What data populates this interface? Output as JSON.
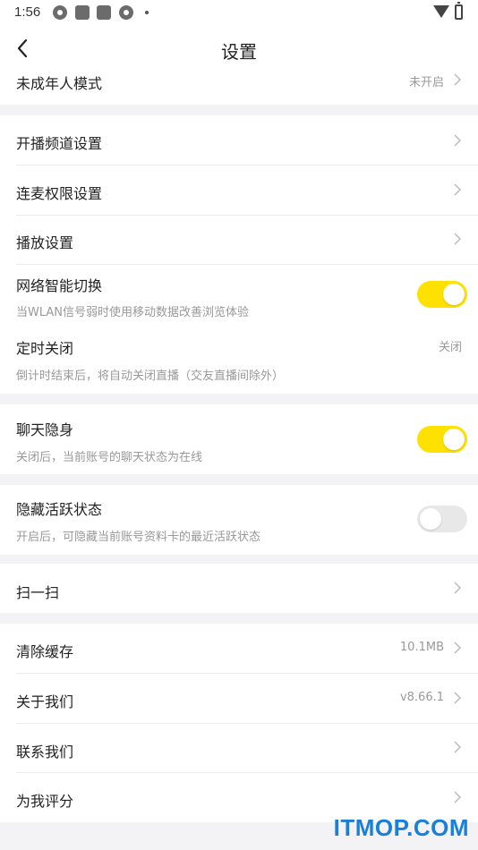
{
  "status_bar": {
    "time": "1:56",
    "icons": [
      "aperture-icon",
      "app-icon",
      "app-icon",
      "aperture-icon",
      "dot-icon",
      "wifi-icon",
      "battery-icon"
    ]
  },
  "nav": {
    "title": "设置",
    "back_icon": "back-arrow-icon"
  },
  "settings": {
    "minor_mode": {
      "title": "未成年人模式",
      "value": "未开启"
    },
    "channel": {
      "title": "开播频道设置"
    },
    "mic_link": {
      "title": "连麦权限设置"
    },
    "playback": {
      "title": "播放设置"
    },
    "network_switch": {
      "title": "网络智能切换",
      "subtitle": "当WLAN信号弱时使用移动数据改善浏览体验",
      "enabled": true
    },
    "timer_off": {
      "title": "定时关闭",
      "subtitle": "倒计时结束后，将自动关闭直播（交友直播间除外）",
      "value": "关闭"
    },
    "chat_invisible": {
      "title": "聊天隐身",
      "subtitle": "关闭后，当前账号的聊天状态为在线",
      "enabled": true
    },
    "hide_activity": {
      "title": "隐藏活跃状态",
      "subtitle": "开启后，可隐藏当前账号资料卡的最近活跃状态",
      "enabled": false
    },
    "scan": {
      "title": "扫一扫"
    },
    "clear_cache": {
      "title": "清除缓存",
      "value": "10.1MB"
    },
    "about": {
      "title": "关于我们",
      "value": "v8.66.1"
    },
    "contact": {
      "title": "联系我们"
    },
    "rate": {
      "title": "为我评分"
    }
  },
  "watermark": "ITMOP.COM",
  "colors": {
    "toggle_on": "#ffe100",
    "toggle_off": "#e8e8e8",
    "section_gap": "#f3f3f5",
    "watermark": "#1a7fd9"
  }
}
